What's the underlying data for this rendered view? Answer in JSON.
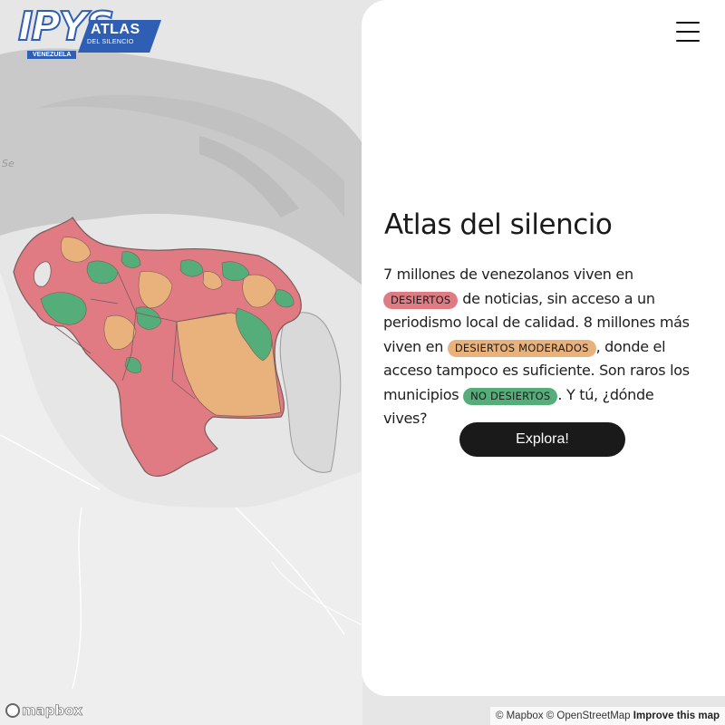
{
  "logo": {
    "mark": "IPYS",
    "title": "ATLAS",
    "subtitle": "DEL SILENCIO",
    "country": "VENEZUELA",
    "color": "#2f5fb4"
  },
  "map": {
    "label": "Se",
    "legend_colors": {
      "desiertos": "#e07b83",
      "moderados": "#e9b27c",
      "no_desiertos": "#55ad7a",
      "neighbor": "#d9d9d9"
    }
  },
  "panel": {
    "menu_icon": "hamburger-menu-icon",
    "title": "Atlas del silencio",
    "text": {
      "p1": "7 millones de venezolanos viven en ",
      "tag1": "DESIERTOS",
      "p2": " de noticias, sin acceso a un periodismo local de calidad. 8 millones más viven en ",
      "tag2": "DESIERTOS MODERADOS",
      "p3": ", donde el acceso tampoco es suficiente. Son raros los municipios ",
      "tag3": "NO DESIERTOS",
      "p4": ". Y tú, ¿dónde vives?"
    },
    "cta": "Explora!"
  },
  "footer": {
    "mapbox_logo": "mapbox",
    "attribution": "© Mapbox © OpenStreetMap",
    "improve": "Improve this map"
  }
}
